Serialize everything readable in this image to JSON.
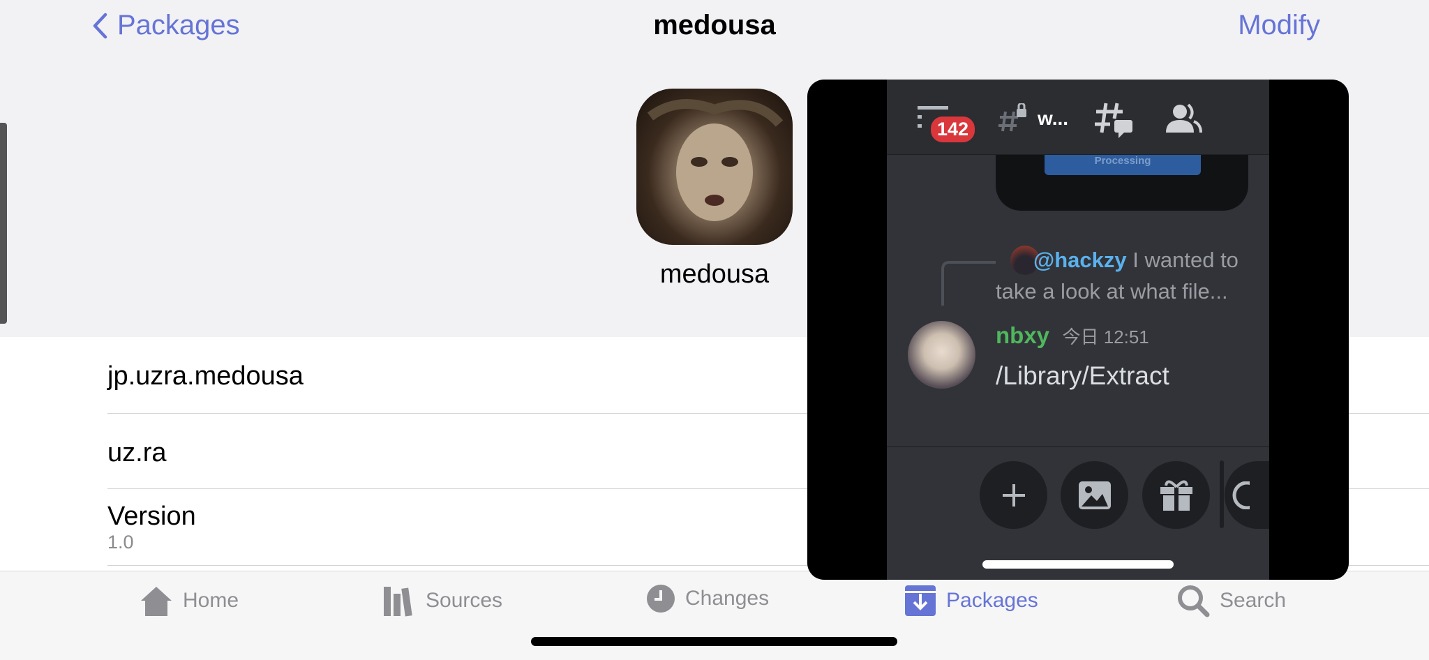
{
  "nav": {
    "back_label": "Packages",
    "title": "medousa",
    "modify_label": "Modify"
  },
  "package": {
    "name": "medousa",
    "icon": "medusa-painting"
  },
  "details": {
    "identifier": "jp.uzra.medousa",
    "author": "uz.ra",
    "version_label": "Version",
    "version_value": "1.0"
  },
  "tabs": [
    {
      "label": "Home",
      "icon": "house-icon"
    },
    {
      "label": "Sources",
      "icon": "books-icon"
    },
    {
      "label": "Changes",
      "icon": "clock-icon"
    },
    {
      "label": "Packages",
      "icon": "package-icon",
      "active": true
    },
    {
      "label": "Search",
      "icon": "magnifier-icon"
    }
  ],
  "colors": {
    "accent": "#6674d6",
    "discord_bg": "#313338",
    "badge": "#da373c",
    "username_green": "#4fb85e",
    "mention_blue": "#5ab1ee"
  },
  "pip": {
    "badge_count": "142",
    "channel_name": "w...",
    "processing_label": "Processing",
    "reply": {
      "mention": "@hackzy",
      "text_line1": "I wanted to",
      "text_line2": "take a look at what file..."
    },
    "message": {
      "author": "nbxy",
      "timestamp": "今日 12:51",
      "text": "/Library/Extract"
    }
  }
}
